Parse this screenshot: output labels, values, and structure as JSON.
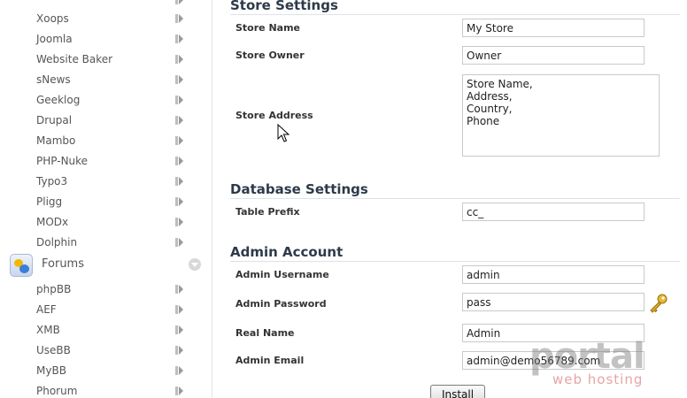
{
  "sidebar": {
    "items_top": [
      "Xoops",
      "Joomla",
      "Website Baker",
      "sNews",
      "Geeklog",
      "Drupal",
      "Mambo",
      "PHP-Nuke",
      "Typo3",
      "Pligg",
      "MODx",
      "Dolphin"
    ],
    "category": {
      "label": "Forums"
    },
    "items_forums": [
      "phpBB",
      "AEF",
      "XMB",
      "UseBB",
      "MyBB",
      "Phorum"
    ]
  },
  "store_settings": {
    "title": "Store Settings",
    "store_name_label": "Store Name",
    "store_name_value": "My Store",
    "store_owner_label": "Store Owner",
    "store_owner_value": "Owner",
    "store_address_label": "Store Address",
    "store_address_value": "Store Name,\nAddress,\nCountry,\nPhone"
  },
  "database_settings": {
    "title": "Database Settings",
    "table_prefix_label": "Table Prefix",
    "table_prefix_value": "cc_"
  },
  "admin_account": {
    "title": "Admin Account",
    "username_label": "Admin Username",
    "username_value": "admin",
    "password_label": "Admin Password",
    "password_value": "pass",
    "real_name_label": "Real Name",
    "real_name_value": "Admin",
    "email_label": "Admin Email",
    "email_value": "admin@demo56789.com"
  },
  "install_label": "Install",
  "watermark": {
    "main": "portal",
    "sub": "web hosting"
  }
}
